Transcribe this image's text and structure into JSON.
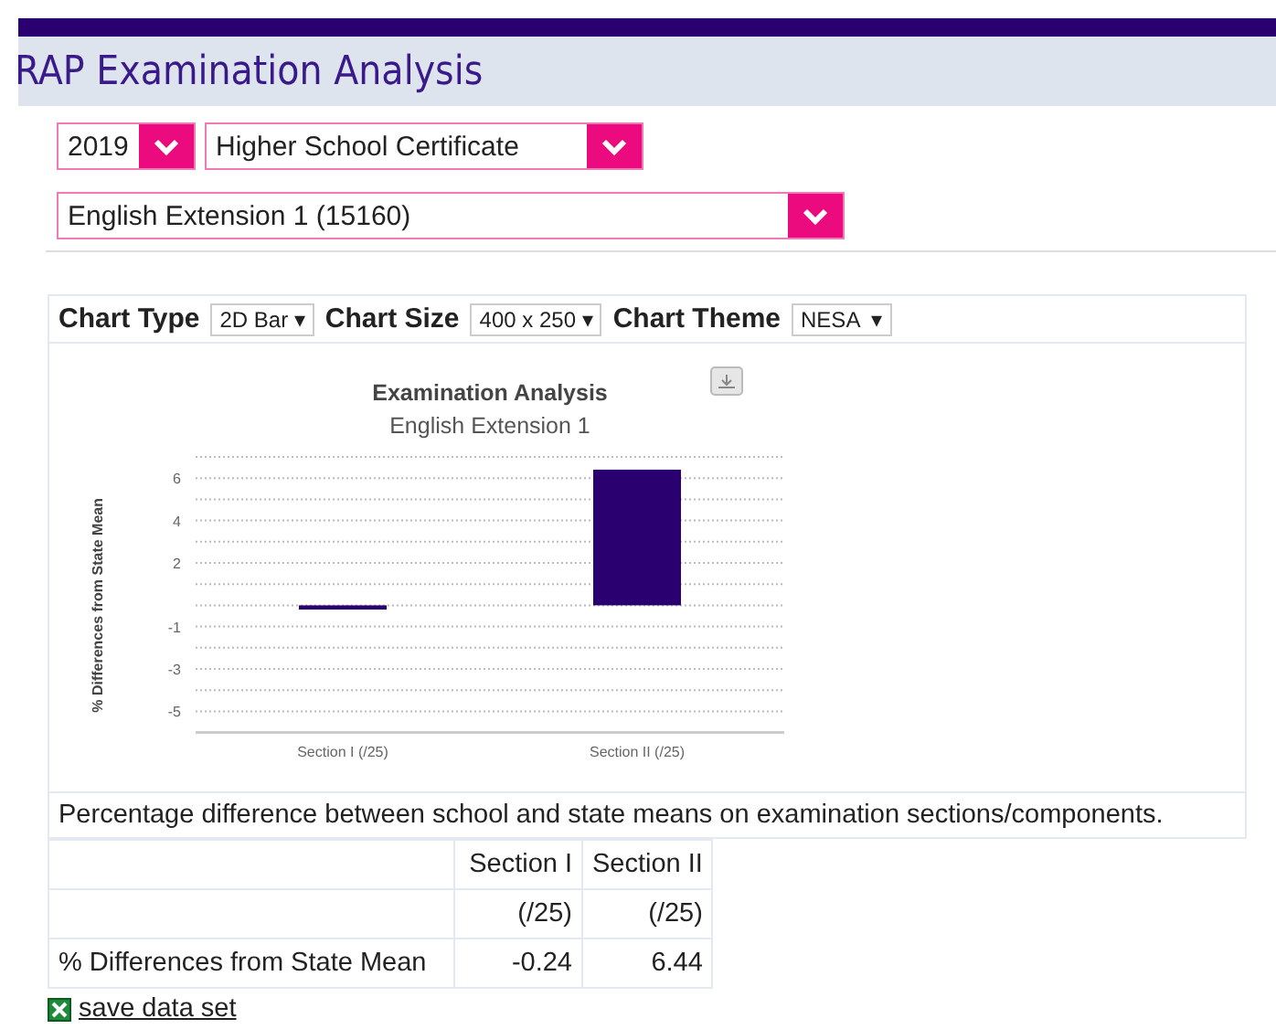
{
  "header": {
    "title": "RAP Examination Analysis"
  },
  "filters": [
    {
      "value": "2019"
    },
    {
      "value": "Higher School Certificate"
    },
    {
      "value": "English Extension 1 (15160)"
    }
  ],
  "chart_options": [
    {
      "label": "Chart Type",
      "value": "2D Bar ▾"
    },
    {
      "label": "Chart Size",
      "value": "400 x 250 ▾"
    },
    {
      "label": "Chart Theme",
      "value": "NESA  ▾"
    }
  ],
  "chart": {
    "chart_data": {
      "type": "bar",
      "title": "Examination Analysis",
      "subtitle": "English Extension 1",
      "ylabel": "% Differences from State Mean",
      "categories": [
        "Section I (/25)",
        "Section II (/25)"
      ],
      "series": [
        {
          "color": "#2a0070",
          "values": [
            -0.2,
            6.4
          ]
        }
      ],
      "grid": true,
      "ylim": [
        -6,
        7
      ],
      "yticks": [
        6,
        4,
        2,
        -1,
        -3,
        -5
      ]
    }
  },
  "caption": "Percentage difference between school and state means on examination sections/components.",
  "table": {
    "columns": [
      {
        "name": "Section I",
        "sub": "(/25)"
      },
      {
        "name": "Section II",
        "sub": "(/25)"
      }
    ],
    "rows": [
      {
        "label": "% Differences from State Mean",
        "values": [
          "-0.24",
          "6.44"
        ]
      }
    ]
  },
  "save_link": "save data set"
}
